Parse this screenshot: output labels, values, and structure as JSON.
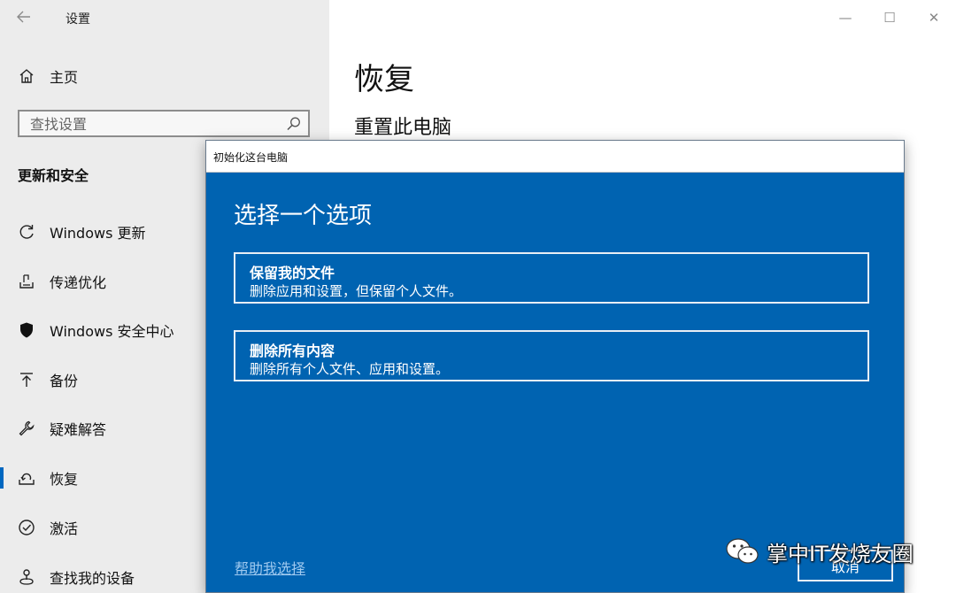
{
  "settings_window": {
    "app_title": "设置",
    "home_label": "主页",
    "search": {
      "placeholder": "查找设置",
      "value": ""
    },
    "section_title": "更新和安全",
    "nav_items": [
      {
        "label": "Windows 更新",
        "icon": "sync-icon"
      },
      {
        "label": "传递优化",
        "icon": "delivery-optimization-icon"
      },
      {
        "label": "Windows 安全中心",
        "icon": "shield-icon"
      },
      {
        "label": "备份",
        "icon": "upload-arrow-icon"
      },
      {
        "label": "疑难解答",
        "icon": "wrench-icon"
      },
      {
        "label": "恢复",
        "icon": "recovery-icon",
        "active": true
      },
      {
        "label": "激活",
        "icon": "check-circle-icon"
      },
      {
        "label": "查找我的设备",
        "icon": "person-location-icon"
      }
    ],
    "page_title": "恢复",
    "page_subtitle": "重置此电脑"
  },
  "dialog": {
    "title": "初始化这台电脑",
    "heading": "选择一个选项",
    "options": [
      {
        "title": "保留我的文件",
        "description": "删除应用和设置，但保留个人文件。"
      },
      {
        "title": "删除所有内容",
        "description": "删除所有个人文件、应用和设置。"
      }
    ],
    "help_link": "帮助我选择",
    "cancel_label": "取消"
  },
  "watermark": {
    "text": "掌中IT发烧友圈",
    "icon": "wechat-icon"
  },
  "colors": {
    "dialog_bg": "#0063b1",
    "sidebar_bg": "#ececec",
    "accent": "#0067c0"
  }
}
